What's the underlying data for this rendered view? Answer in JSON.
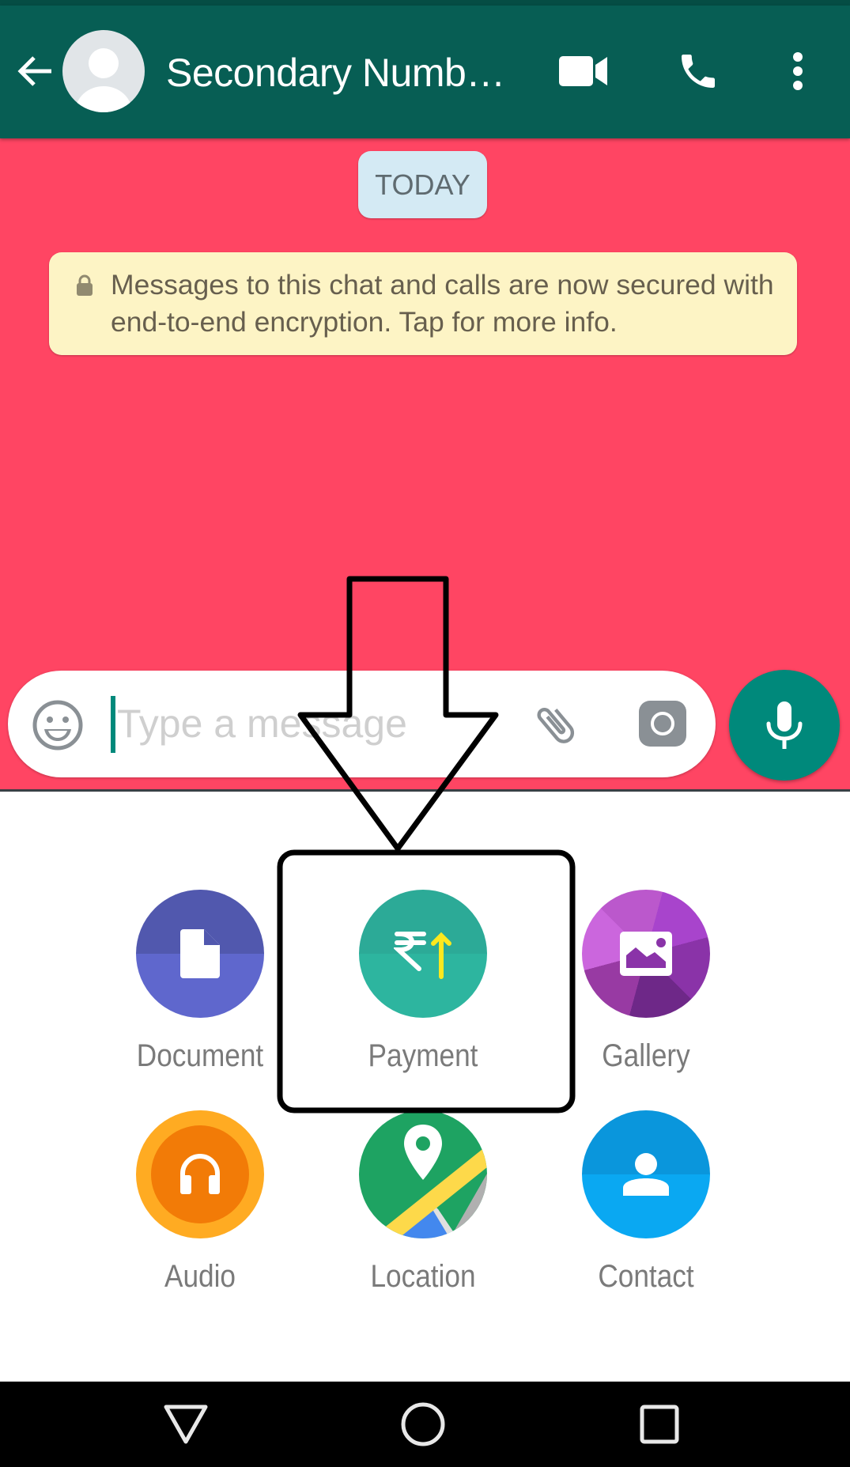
{
  "header": {
    "title": "Secondary Numb…",
    "back_icon": "arrow-left-icon",
    "avatar_icon": "default-avatar-icon",
    "actions": [
      {
        "name": "video-call",
        "icon": "video-camera-icon"
      },
      {
        "name": "voice-call",
        "icon": "phone-icon"
      },
      {
        "name": "more-options",
        "icon": "more-vertical-icon"
      }
    ]
  },
  "chat": {
    "date_chip": "TODAY",
    "encryption_notice": "Messages to this chat and calls are now secured with end-to-end encryption. Tap for more info.",
    "background_color": "#ff4563"
  },
  "composer": {
    "placeholder": "Type a message",
    "value": "",
    "emoji_icon": "emoji-icon",
    "attach_icon": "paperclip-icon",
    "camera_icon": "camera-icon",
    "send_icon": "microphone-icon"
  },
  "attachments": [
    {
      "label": "Document",
      "icon": "document-icon",
      "color": "#5f67cd"
    },
    {
      "label": "Payment",
      "icon": "rupee-upload-icon",
      "color": "#2db39e"
    },
    {
      "label": "Gallery",
      "icon": "image-icon",
      "color": "#a844cc"
    },
    {
      "label": "Audio",
      "icon": "headphones-icon",
      "color": "#f27b07"
    },
    {
      "label": "Location",
      "icon": "map-pin-icon",
      "color": "#1ea362"
    },
    {
      "label": "Contact",
      "icon": "person-icon",
      "color": "#0aa8f2"
    }
  ],
  "annotation": {
    "highlighted_item": "Payment",
    "shape": "down-arrow-and-box"
  },
  "navbar": {
    "buttons": [
      "back",
      "home",
      "recents"
    ]
  },
  "colors": {
    "header": "#075e54",
    "accent": "#00897b"
  }
}
